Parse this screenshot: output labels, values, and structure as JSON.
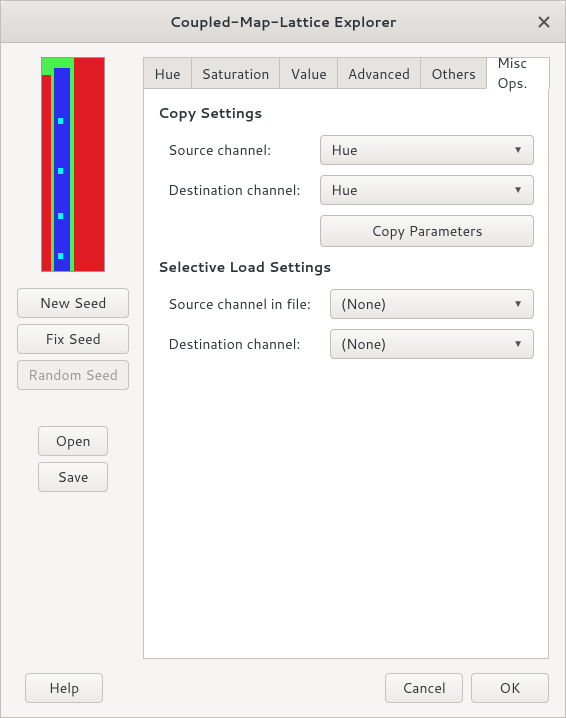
{
  "window": {
    "title": "Coupled-Map-Lattice Explorer"
  },
  "left": {
    "new_seed": "New Seed",
    "fix_seed": "Fix Seed",
    "random_seed": "Random Seed",
    "open": "Open",
    "save": "Save"
  },
  "tabs": {
    "hue": "Hue",
    "saturation": "Saturation",
    "value": "Value",
    "advanced": "Advanced",
    "others": "Others",
    "misc": "Misc Ops."
  },
  "misc": {
    "copy_section": "Copy Settings",
    "src_label": "Source channel:",
    "dst_label": "Destination channel:",
    "src_value": "Hue",
    "dst_value": "Hue",
    "copy_button": "Copy Parameters",
    "load_section": "Selective Load Settings",
    "file_src_label": "Source channel in file:",
    "file_dst_label": "Destination channel:",
    "file_src_value": "(None)",
    "file_dst_value": "(None)"
  },
  "footer": {
    "help": "Help",
    "cancel": "Cancel",
    "ok": "OK"
  }
}
